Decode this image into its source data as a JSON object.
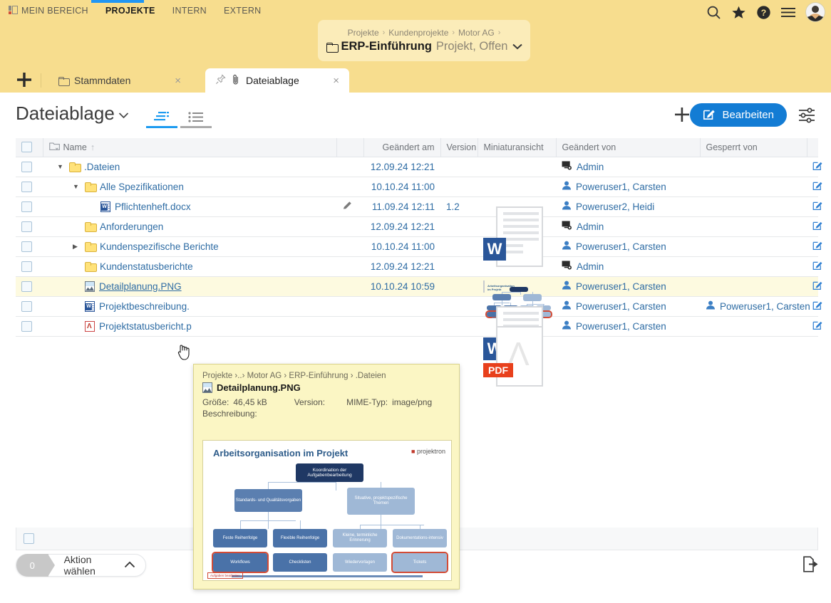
{
  "header": {
    "nav": [
      {
        "label": "MEIN BEREICH",
        "active": false,
        "icon": "dashboard-icon"
      },
      {
        "label": "PROJEKTE",
        "active": true
      },
      {
        "label": "INTERN",
        "active": false
      },
      {
        "label": "EXTERN",
        "active": false
      }
    ],
    "icons": [
      "search-icon",
      "star-icon",
      "help-icon",
      "menu-icon",
      "avatar"
    ],
    "accent_color": "#2196f3",
    "background_color": "#f7dd8e"
  },
  "breadcrumb": {
    "path": [
      "Projekte",
      "Kundenprojekte",
      "Motor AG"
    ],
    "separator": "›",
    "title": "ERP-Einführung",
    "meta": "Projekt, Offen"
  },
  "tabs": [
    {
      "label": "Stammdaten",
      "active": false,
      "icon": "folder-icon",
      "close": "×"
    },
    {
      "label": "Dateiablage",
      "active": true,
      "icon": "paperclip-icon",
      "pin": "pin-icon",
      "close": "×"
    }
  ],
  "tab_add_label": "+",
  "toolbar": {
    "title": "Dateiablage",
    "add_label": "+",
    "edit_label": "Bearbeiten",
    "view_tree": "tree-view-icon",
    "view_list": "list-view-icon",
    "settings": "settings-sliders-icon"
  },
  "table": {
    "columns": [
      {
        "key": "check",
        "label": ""
      },
      {
        "key": "name",
        "label": "Name",
        "sort": "↑"
      },
      {
        "key": "edit_mark",
        "label": ""
      },
      {
        "key": "modified",
        "label": "Geändert am"
      },
      {
        "key": "version",
        "label": "Version"
      },
      {
        "key": "thumbnail",
        "label": "Miniaturansicht"
      },
      {
        "key": "modified_by",
        "label": "Geändert von"
      },
      {
        "key": "locked_by",
        "label": "Gesperrt von"
      },
      {
        "key": "action",
        "label": ""
      }
    ],
    "rows": [
      {
        "indent": 1,
        "twisty": "▼",
        "type": "folder",
        "name": ".Dateien",
        "modified": "12.09.24 12:21",
        "version": "",
        "modified_by": "Admin",
        "modified_by_icon": "admin-icon",
        "locked_by": "",
        "highlight": false,
        "tall": false,
        "thumbnail": "",
        "pencil": false
      },
      {
        "indent": 2,
        "twisty": "▼",
        "type": "folder",
        "name": "Alle Spezifikationen",
        "modified": "10.10.24 11:00",
        "version": "",
        "modified_by": "Poweruser1, Carsten",
        "modified_by_icon": "user-icon",
        "locked_by": "",
        "highlight": false,
        "tall": false,
        "thumbnail": "",
        "pencil": false
      },
      {
        "indent": 3,
        "twisty": "",
        "type": "docx",
        "name": "Pflichtenheft.docx",
        "modified": "11.09.24 12:11",
        "version": "1.2",
        "modified_by": "Poweruser2, Heidi",
        "modified_by_icon": "user-icon",
        "locked_by": "",
        "highlight": false,
        "tall": true,
        "thumbnail": "word-doc-thumb",
        "pencil": true
      },
      {
        "indent": 2,
        "twisty": "",
        "type": "folder",
        "name": "Anforderungen",
        "modified": "12.09.24 12:21",
        "version": "",
        "modified_by": "Admin",
        "modified_by_icon": "admin-icon",
        "locked_by": "",
        "highlight": false,
        "tall": false,
        "thumbnail": "",
        "pencil": false
      },
      {
        "indent": 2,
        "twisty": "▶",
        "type": "folder",
        "name": "Kundenspezifische Berichte",
        "modified": "10.10.24 11:00",
        "version": "",
        "modified_by": "Poweruser1, Carsten",
        "modified_by_icon": "user-icon",
        "locked_by": "",
        "highlight": false,
        "tall": false,
        "thumbnail": "",
        "pencil": false
      },
      {
        "indent": 2,
        "twisty": "",
        "type": "folder",
        "name": "Kundenstatusberichte",
        "modified": "12.09.24 12:21",
        "version": "",
        "modified_by": "Admin",
        "modified_by_icon": "admin-icon",
        "locked_by": "",
        "highlight": false,
        "tall": false,
        "thumbnail": "",
        "pencil": false
      },
      {
        "indent": 2,
        "twisty": "",
        "type": "png",
        "name": "Detailplanung.PNG",
        "modified": "10.10.24 10:59",
        "version": "",
        "modified_by": "Poweruser1, Carsten",
        "modified_by_icon": "user-icon",
        "locked_by": "",
        "highlight": true,
        "tall": true,
        "thumbnail": "diagram-thumb",
        "pencil": false
      },
      {
        "indent": 2,
        "twisty": "",
        "type": "docx",
        "name": "Projektbeschreibung.",
        "modified": "",
        "version": "",
        "modified_by": "Poweruser1, Carsten",
        "modified_by_icon": "user-icon",
        "locked_by": "Poweruser1, Carsten",
        "locked_by_icon": "user-icon",
        "highlight": false,
        "tall": true,
        "thumbnail": "word-doc-thumb",
        "pencil": false
      },
      {
        "indent": 2,
        "twisty": "",
        "type": "pdf",
        "name": "Projektstatusbericht.p",
        "modified": "",
        "version": "",
        "modified_by": "Poweruser1, Carsten",
        "modified_by_icon": "user-icon",
        "locked_by": "",
        "highlight": false,
        "tall": true,
        "thumbnail": "pdf-doc-thumb",
        "pencil": false
      }
    ]
  },
  "tooltip": {
    "breadcrumb": "Projekte ›..› Motor AG › ERP-Einführung › .Dateien",
    "filename": "Detailplanung.PNG",
    "size_label": "Größe:",
    "size_value": "46,45 kB",
    "version_label": "Version:",
    "version_value": "",
    "mime_label": "MIME-Typ:",
    "mime_value": "image/png",
    "description_label": "Beschreibung:",
    "preview": {
      "title": "Arbeitsorganisation im Projekt",
      "logo": "projektron",
      "boxes": [
        "Koordination der Aufgabenbearbeitung",
        "Standards- und Qualitätsvorgaben",
        "Situative, projektspezifische Themen",
        "Feste Reihenfolge",
        "Flexible Reihenfolge",
        "Kleine, terminliche Erinnerung",
        "Dokumentations-intensiv",
        "Workflows",
        "Checklisten",
        "Wiedervorlagen",
        "Tickets"
      ],
      "footnote": "Aufgaben bearbeiten"
    }
  },
  "footer": {
    "count": "0",
    "action_label": "Aktion wählen",
    "caret": "∧",
    "export_icon": "export-file-icon"
  }
}
